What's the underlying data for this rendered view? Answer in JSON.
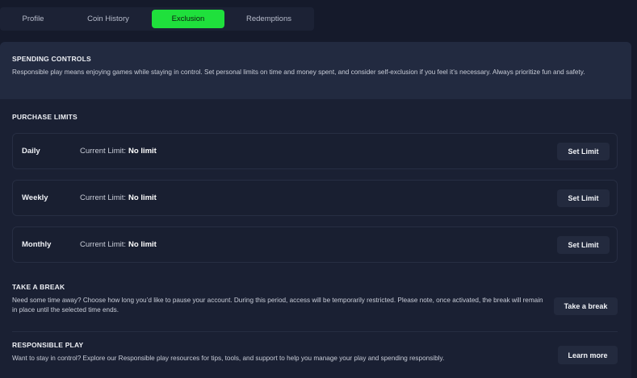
{
  "tabs": [
    {
      "label": "Profile"
    },
    {
      "label": "Coin History"
    },
    {
      "label": "Exclusion"
    },
    {
      "label": "Redemptions"
    }
  ],
  "active_tab": "Exclusion",
  "spending_controls": {
    "title": "SPENDING CONTROLS",
    "description": "Responsible play means enjoying games while staying in control. Set personal limits on time and money spent, and consider self-exclusion if you feel it’s necessary. Always prioritize fun and safety."
  },
  "purchase_limits": {
    "title": "PURCHASE LIMITS",
    "current_limit_label": "Current Limit:",
    "rows": [
      {
        "name": "Daily",
        "value": "No limit",
        "button": "Set Limit"
      },
      {
        "name": "Weekly",
        "value": "No limit",
        "button": "Set Limit"
      },
      {
        "name": "Monthly",
        "value": "No limit",
        "button": "Set Limit"
      }
    ]
  },
  "take_a_break": {
    "title": "TAKE A BREAK",
    "description": "Need some time away? Choose how long you’d like to pause your account. During this period, access will be temporarily restricted. Please note, once activated, the break will remain in place until the selected time ends.",
    "button": "Take a break"
  },
  "responsible_play": {
    "title": "RESPONSIBLE PLAY",
    "description": "Want to stay in control? Explore our Responsible play resources for tips, tools, and support to help you manage your play and spending responsibly.",
    "button": "Learn more"
  },
  "colors": {
    "accent": "#1fe03c",
    "background": "#151a2b",
    "card": "#1a2033"
  }
}
